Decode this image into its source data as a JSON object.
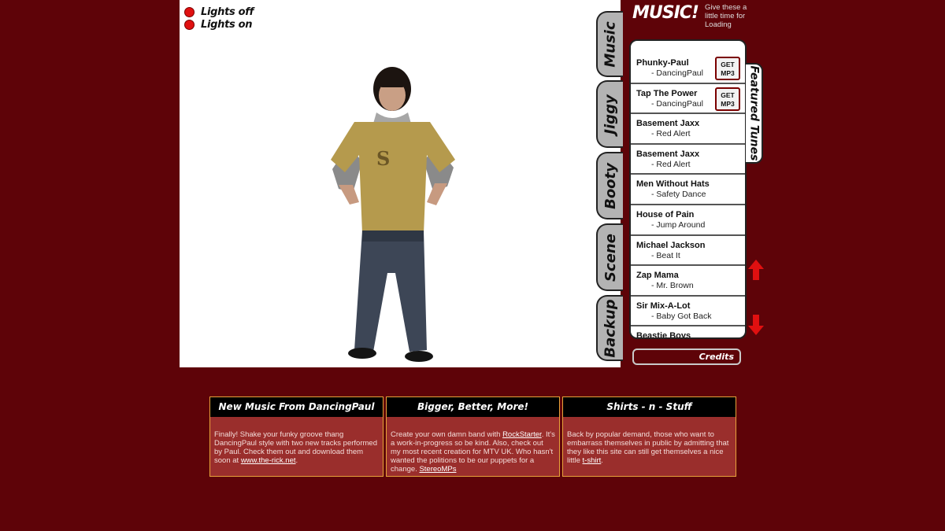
{
  "lights": [
    {
      "label": "Lights off"
    },
    {
      "label": "Lights on"
    }
  ],
  "vertical_tabs": [
    "Music",
    "Jiggy",
    "Booty",
    "Scene",
    "Backup"
  ],
  "music_panel": {
    "title": "MUSIC!",
    "loading_note": "Give these a little time for Loading",
    "featured_tab": "Featured Tunes",
    "tracks": [
      {
        "artist": "Phunky-Paul",
        "title": "- DancingPaul",
        "mp3": true
      },
      {
        "artist": "Tap The Power",
        "title": "- DancingPaul",
        "mp3": true
      },
      {
        "artist": "Basement Jaxx",
        "title": "- Red Alert",
        "mp3": false
      },
      {
        "artist": "Basement Jaxx",
        "title": "- Red Alert",
        "mp3": false
      },
      {
        "artist": "Men Without Hats",
        "title": "- Safety Dance",
        "mp3": false
      },
      {
        "artist": "House of Pain",
        "title": "- Jump Around",
        "mp3": false
      },
      {
        "artist": "Michael Jackson",
        "title": "- Beat It",
        "mp3": false
      },
      {
        "artist": "Zap Mama",
        "title": "- Mr. Brown",
        "mp3": false
      },
      {
        "artist": "Sir Mix-A-Lot",
        "title": "- Baby Got Back",
        "mp3": false
      },
      {
        "artist": "Beastie Boys",
        "title": "",
        "mp3": false
      }
    ],
    "mp3_label_1": "GET",
    "mp3_label_2": "MP3",
    "credits": "Credits"
  },
  "news": [
    {
      "heading": "New Music From DancingPaul",
      "text_1": "Finally! Shake your funky groove thang DancingPaul style with two new tracks performed by Paul. Check them out and download them soon at ",
      "link_1": "www.the-rick.net",
      "text_2": "."
    },
    {
      "heading": "Bigger, Better, More!",
      "text_1": "Create your own damn band with ",
      "link_1": "RockStarter",
      "text_2": ". It's a work-in-progress so be kind. Also, check out my most recent creation for MTV UK. Who hasn't wanted the politions to be our puppets for a change. ",
      "link_2": "StereoMPs"
    },
    {
      "heading": "Shirts - n - Stuff",
      "text_1": "Back by popular demand, those who want to embarrass themselves in public by admitting that they like this site can still get themselves a nice little ",
      "link_1": "t-shirt",
      "text_2": "."
    }
  ],
  "colors": {
    "background": "#5e0308",
    "news_box": "#9a2e2c",
    "news_border": "#e8a33a",
    "light_button": "#e01010",
    "arrow": "#e01010"
  }
}
